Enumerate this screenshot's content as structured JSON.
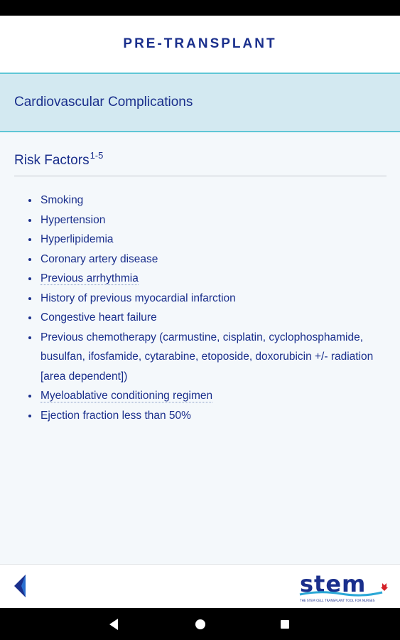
{
  "header": {
    "title": "PRE-TRANSPLANT"
  },
  "section": {
    "title": "Cardiovascular Complications"
  },
  "risk": {
    "heading": "Risk Factors",
    "superscript": "1-5",
    "items": [
      "Smoking",
      "Hypertension",
      "Hyperlipidemia",
      "Coronary artery disease",
      "Previous arrhythmia",
      "History of previous myocardial infarction",
      "Congestive heart failure",
      "Previous chemotherapy (carmustine, cisplatin, cyclophosphamide, busulfan, ifosfamide, cytarabine, etoposide, doxorubicin +/- radiation [area dependent])",
      "Myeloablative conditioning regimen",
      "Ejection fraction less than 50%"
    ]
  },
  "logo": {
    "wordmark": "stem",
    "tagline": "THE STEM CELL TRANSPLANT TOOL FOR NURSES"
  },
  "colors": {
    "primary": "#1a2f8c",
    "accent": "#5fc6d6",
    "section_bg": "#d3e9f1",
    "content_bg": "#f4f8fb"
  },
  "icons": {
    "back": "back-triangle-icon",
    "nav_back": "nav-back-icon",
    "nav_home": "nav-home-icon",
    "nav_recents": "nav-recents-icon"
  }
}
